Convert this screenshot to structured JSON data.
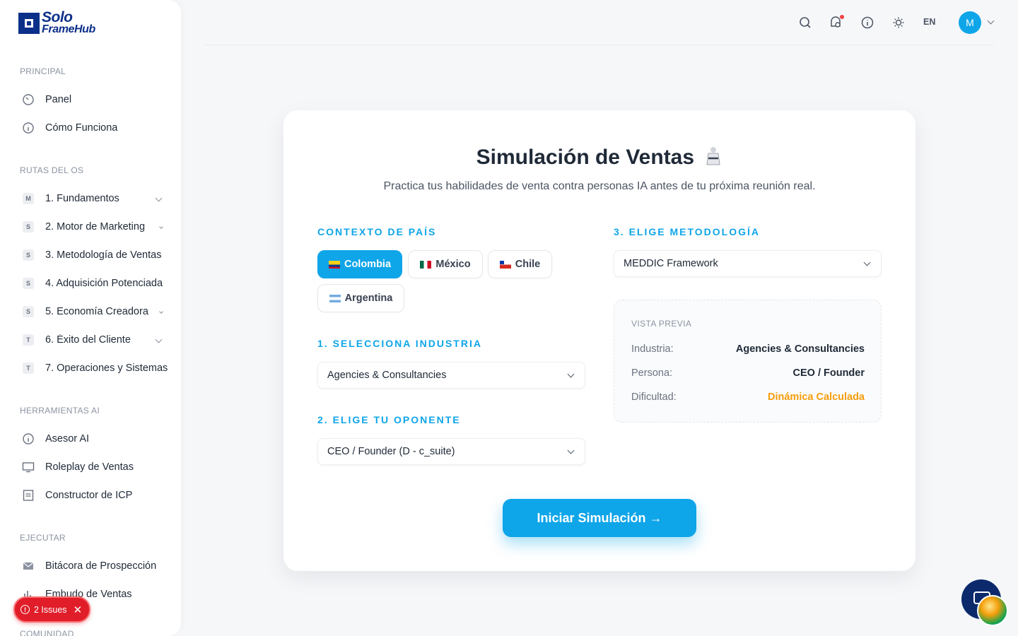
{
  "brand": {
    "line1": "Solo",
    "line2": "FrameHub"
  },
  "sidebar": {
    "sections": [
      {
        "title": "PRINCIPAL"
      },
      {
        "title": "RUTAS DEL OS"
      },
      {
        "title": "HERRAMIENTAS AI"
      },
      {
        "title": "EJECUTAR"
      },
      {
        "title": "COMUNIDAD"
      }
    ],
    "principal": [
      {
        "label": "Panel",
        "icon": "gauge-icon"
      },
      {
        "label": "Cómo Funciona",
        "icon": "info-icon"
      }
    ],
    "rutas": [
      {
        "badge": "M",
        "label": "1. Fundamentos"
      },
      {
        "badge": "S",
        "label": "2. Motor de Marketing"
      },
      {
        "badge": "S",
        "label": "3. Metodología de Ventas"
      },
      {
        "badge": "S",
        "label": "4. Adquisición Potenciada"
      },
      {
        "badge": "S",
        "label": "5. Economía Creadora"
      },
      {
        "badge": "T",
        "label": "6. Éxito del Cliente"
      },
      {
        "badge": "T",
        "label": "7. Operaciones y Sistemas"
      }
    ],
    "herramientas": [
      {
        "label": "Asesor AI",
        "icon": "info-icon"
      },
      {
        "label": "Roleplay de Ventas",
        "icon": "monitor-icon"
      },
      {
        "label": "Constructor de ICP",
        "icon": "document-icon"
      }
    ],
    "ejecutar": [
      {
        "label": "Bitácora de Prospección",
        "icon": "mail-icon"
      },
      {
        "label": "Embudo de Ventas",
        "icon": "bar-chart-icon"
      }
    ]
  },
  "issues": {
    "label": "2 Issues"
  },
  "topbar": {
    "lang": "EN",
    "avatar_initial": "M"
  },
  "main": {
    "title": "Simulación de Ventas",
    "subtitle": "Practica tus habilidades de venta contra personas IA antes de tu próxima reunión real.",
    "country_label": "CONTEXTO DE PAÍS",
    "countries": [
      {
        "label": "Colombia",
        "active": true
      },
      {
        "label": "México",
        "active": false
      },
      {
        "label": "Chile",
        "active": false
      },
      {
        "label": "Argentina",
        "active": false
      }
    ],
    "industry_label": "1. SELECCIONA INDUSTRIA",
    "industry_value": "Agencies & Consultancies",
    "opponent_label": "2. ELIGE TU OPONENTE",
    "opponent_value": "CEO / Founder (D - c_suite)",
    "method_label": "3. ELIGE METODOLOGÍA",
    "method_value": "MEDDIC Framework",
    "preview": {
      "heading": "VISTA PREVIA",
      "rows": [
        {
          "key": "Industria:",
          "value": "Agencies & Consultancies"
        },
        {
          "key": "Persona:",
          "value": "CEO / Founder"
        },
        {
          "key": "Dificultad:",
          "value": "Dinámica Calculada"
        }
      ]
    },
    "cta": "Iniciar Simulación →"
  }
}
